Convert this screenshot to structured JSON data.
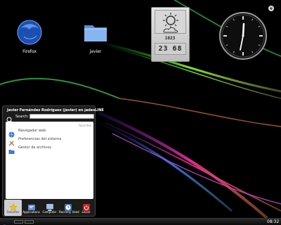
{
  "desktop": {
    "icons": [
      {
        "label": "Firefox",
        "icon": "firefox-icon"
      },
      {
        "label": "javier",
        "icon": "folder-icon"
      }
    ]
  },
  "weather_widget": {
    "date": "1023",
    "temp_left": "23",
    "temp_right": "68",
    "condition_icon": "sun-cloud-icon"
  },
  "clock_widget": {
    "time": "01:32"
  },
  "start_menu": {
    "user_line": "Javier Fernández Rodríguez (javier) en jadesLINE",
    "search_label": "Search:",
    "search_placeholder": "",
    "favorites_label": "Favorites",
    "favorites": [
      {
        "label": "Navegador web",
        "icon": "globe-icon"
      },
      {
        "label": "Preferencias del sistema",
        "icon": "tools-icon"
      },
      {
        "label": "Gestor de archivos",
        "icon": "folder-icon"
      }
    ],
    "tabs": [
      {
        "label": "Favorites",
        "icon": "star-icon"
      },
      {
        "label": "Applications",
        "icon": "applications-icon"
      },
      {
        "label": "Computer",
        "icon": "computer-icon"
      },
      {
        "label": "Recently Used",
        "icon": "clock-icon"
      },
      {
        "label": "Leave",
        "icon": "power-icon"
      }
    ]
  },
  "taskbar": {
    "clock": "08:32"
  },
  "colors": {
    "accent_green": "#63e02a",
    "accent_pink": "#e02a8f",
    "accent_blue": "#2a6fe0",
    "leave_red": "#c81e1e",
    "star_yellow": "#f2c21a"
  }
}
